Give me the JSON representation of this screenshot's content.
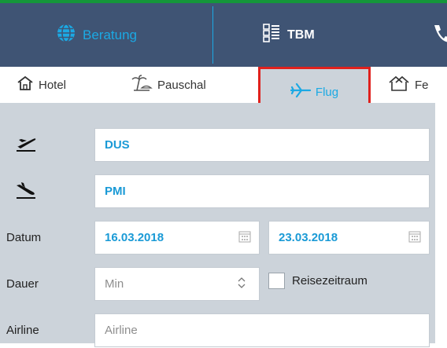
{
  "topnav": {
    "tabs": [
      {
        "label": "Beratung",
        "icon": "globe-icon"
      },
      {
        "label": "TBM",
        "icon": "list-icon"
      },
      {
        "label": "",
        "icon": "phone-icon"
      }
    ]
  },
  "subnav": {
    "tabs": [
      {
        "label": "Hotel",
        "icon": "house-icon"
      },
      {
        "label": "Pauschal",
        "icon": "beach-icon"
      },
      {
        "label": "Flug",
        "icon": "plane-icon",
        "selected": true
      },
      {
        "label": "Fe",
        "icon": "holiday-home-icon"
      }
    ]
  },
  "form": {
    "departure": {
      "value": "DUS",
      "icon": "takeoff-icon"
    },
    "arrival": {
      "value": "PMI",
      "icon": "landing-icon"
    },
    "datum": {
      "label": "Datum",
      "from": "16.03.2018",
      "to": "23.03.2018",
      "icon": "calendar-icon"
    },
    "dauer": {
      "label": "Dauer",
      "placeholder": "Min",
      "icon": "stepper-icon"
    },
    "reisezeitraum": {
      "label": "Reisezeitraum",
      "checked": false
    },
    "airline": {
      "label": "Airline",
      "placeholder": "Airline"
    }
  },
  "colors": {
    "header_bg": "#3f5474",
    "accent": "#1ba9e4",
    "green_top": "#15963a",
    "form_bg": "#ccd3da",
    "selection_highlight": "#e0211d"
  }
}
